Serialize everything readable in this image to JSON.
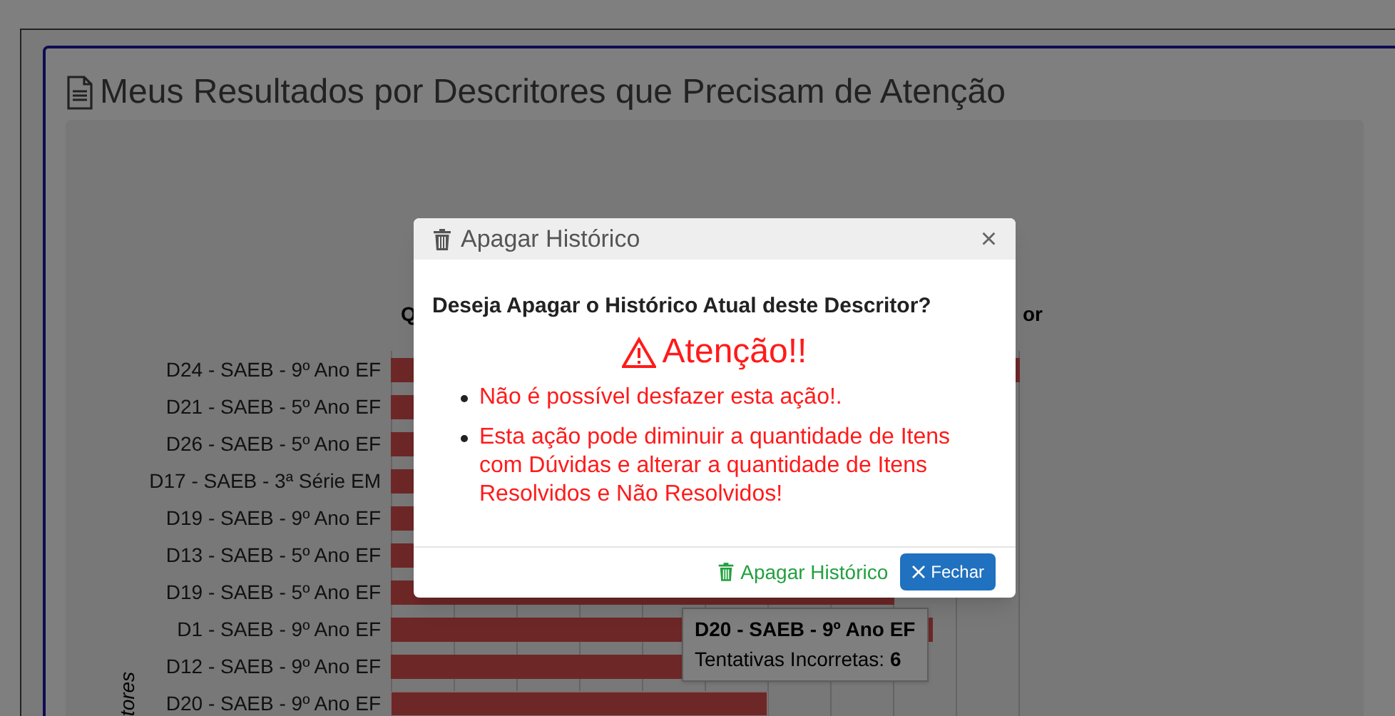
{
  "panel": {
    "title": "Meus Resultados por Descritores que Precisam de Atenção"
  },
  "chart": {
    "title_start": "Q",
    "title_end": "or",
    "axis_label": "tores",
    "bar_labels": [
      "D24 - SAEB - 9º Ano EF",
      "D21 - SAEB - 5º Ano EF",
      "D26 - SAEB - 5º Ano EF",
      "D17 - SAEB - 3ª Série EM",
      "D19 - SAEB - 9º Ano EF",
      "D13 - SAEB - 5º Ano EF",
      "D19 - SAEB - 5º Ano EF",
      "D1 - SAEB - 9º Ano EF",
      "D12 - SAEB - 9º Ano EF",
      "D20 - SAEB - 9º Ano EF"
    ],
    "tooltip": {
      "title": "D20 - SAEB - 9º Ano EF",
      "label": "Tentativas Incorretas:",
      "value": "6"
    }
  },
  "modal": {
    "title": "Apagar Histórico",
    "close": "×",
    "question": "Deseja Apagar o Histórico Atual deste Descritor?",
    "warning": "Atenção!!",
    "bullets": [
      "Não é possível desfazer esta ação!.",
      "Esta ação pode diminuir a quantidade de Itens com Dúvidas e alterar a quantidade de Itens Resolvidos e Não Resolvidos!"
    ],
    "buttons": [
      {
        "kind": "link",
        "label": "Apagar Histórico"
      },
      {
        "kind": "primary",
        "label": "Fechar"
      }
    ]
  }
}
